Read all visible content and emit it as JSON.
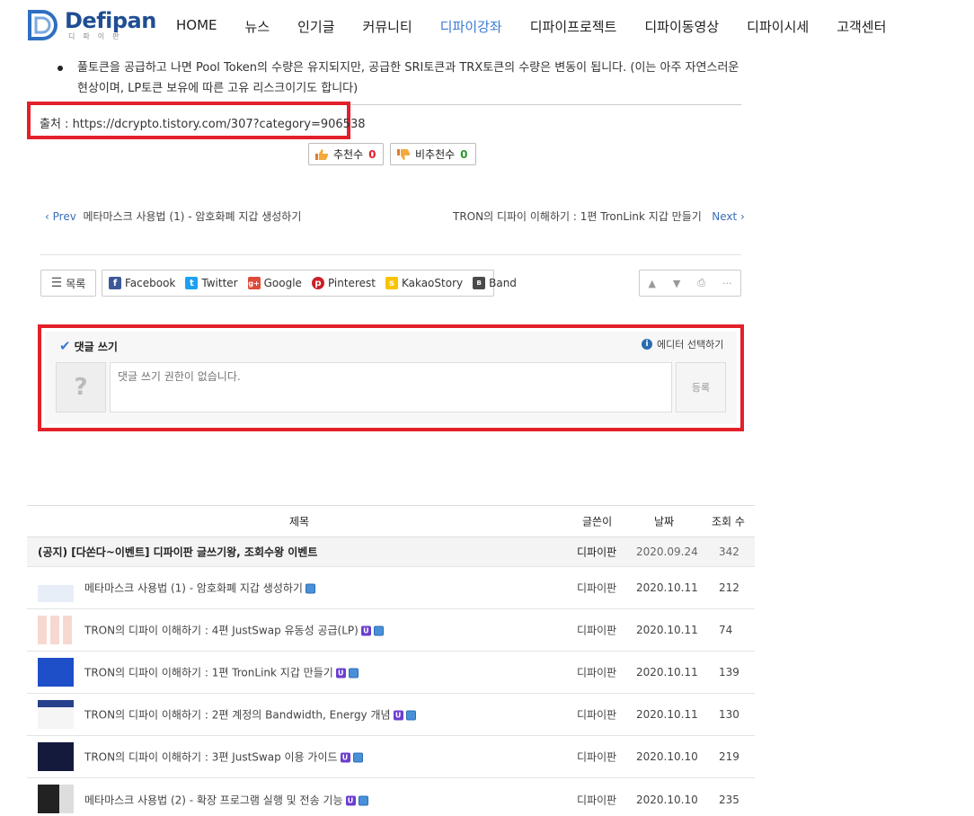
{
  "header": {
    "logo_name": "Defipan",
    "logo_sub": "디파이판",
    "nav": [
      "HOME",
      "뉴스",
      "인기글",
      "커뮤니티",
      "디파이강좌",
      "디파이프로젝트",
      "디파이동영상",
      "디파이시세",
      "고객센터"
    ],
    "active_nav": "디파이강좌",
    "brand_color": "#1f4e93",
    "active_color": "#3a7bd5"
  },
  "article": {
    "bullets": [
      "풀토큰을 공급하고 나면 Pool Token의 수량은 유지되지만, 공급한 SRI토큰과 TRX토큰의 수량은 변동이 됩니다. (이는 아주 자연스러운 현상이며, LP토큰 보유에 따른 고유 리스크이기도 합니다)"
    ],
    "source": "출처 : https://dcrypto.tistory.com/307?category=906538"
  },
  "votes": {
    "up_label": "추천수",
    "up_count": "0",
    "down_label": "비추천수",
    "down_count": "0"
  },
  "prev_next": {
    "prev_label": "Prev",
    "prev_title": "메타마스크 사용법 (1) - 암호화폐 지갑 생성하기",
    "next_title": "TRON의 디파이 이해하기 : 1편 TronLink 지갑 만들기",
    "next_label": "Next"
  },
  "toolbar": {
    "list_label": "목록",
    "share": [
      "Facebook",
      "Twitter",
      "Google",
      "Pinterest",
      "KakaoStory",
      "Band"
    ]
  },
  "comment": {
    "title": "댓글 쓰기",
    "editor_select": "에디터 선택하기",
    "placeholder": "댓글 쓰기 권한이 없습니다.",
    "submit": "등록"
  },
  "table": {
    "headers": [
      "제목",
      "글쓴이",
      "날짜",
      "조회 수"
    ],
    "rows": [
      {
        "title": "(공지) [다쏜다~이벤트] 디파이판 글쓰기왕, 조회수왕 이벤트",
        "author": "디파이판",
        "date": "2020.09.24",
        "views": "342",
        "notice": true
      },
      {
        "title": "메타마스크 사용법 (1) - 암호화폐 지갑 생성하기",
        "author": "디파이판",
        "date": "2020.10.11",
        "views": "212"
      },
      {
        "title": "TRON의 디파이 이해하기 : 4편 JustSwap 유동성 공급(LP)",
        "author": "디파이판",
        "date": "2020.10.11",
        "views": "74"
      },
      {
        "title": "TRON의 디파이 이해하기 : 1편 TronLink 지갑 만들기",
        "author": "디파이판",
        "date": "2020.10.11",
        "views": "139"
      },
      {
        "title": "TRON의 디파이 이해하기 : 2편 계정의 Bandwidth, Energy 개념",
        "author": "디파이판",
        "date": "2020.10.11",
        "views": "130"
      },
      {
        "title": "TRON의 디파이 이해하기 : 3편 JustSwap 이용 가이드",
        "author": "디파이판",
        "date": "2020.10.10",
        "views": "219"
      },
      {
        "title": "메타마스크 사용법 (2) - 확장 프로그램 실행 및 전송 기능",
        "author": "디파이판",
        "date": "2020.10.10",
        "views": "235"
      }
    ]
  }
}
